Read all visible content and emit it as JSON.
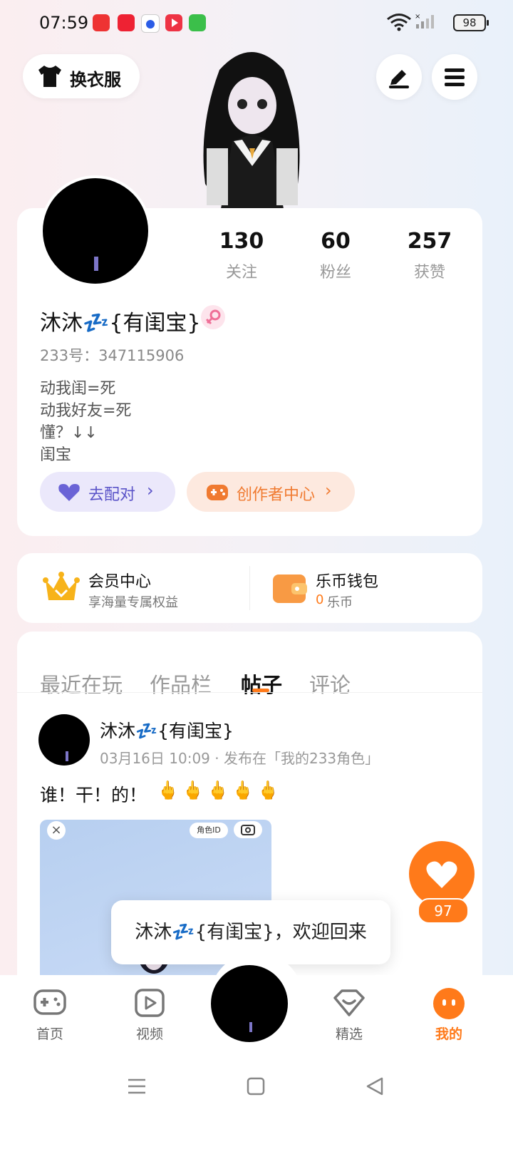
{
  "status_bar": {
    "time": "07:59",
    "battery": "98"
  },
  "header": {
    "outfit_label": "换衣服"
  },
  "profile": {
    "stats": [
      {
        "value": "130",
        "label": "关注"
      },
      {
        "value": "60",
        "label": "粉丝"
      },
      {
        "value": "257",
        "label": "获赞"
      }
    ],
    "name": "沐沐💤{有闺宝}",
    "account_id": "233号：347115906",
    "bio": [
      "动我闺=死",
      "动我好友=死",
      "懂？↓↓",
      "闺宝"
    ],
    "match_button": "去配对",
    "creator_button": "创作者中心"
  },
  "services": {
    "vip_title": "会员中心",
    "vip_subtitle": "享海量专属权益",
    "wallet_title": "乐币钱包",
    "wallet_amount": "0",
    "wallet_unit": "乐币"
  },
  "tabs": [
    "最近在玩",
    "作品栏",
    "帖子",
    "评论"
  ],
  "active_tab": "帖子",
  "post": {
    "author": "沐沐💤{有闺宝}",
    "meta": "03月16日 10:09 · 发布在「我的233角色」",
    "text": "谁！干！的！",
    "emojis": "🖕🖕🖕🖕🖕",
    "image_tag": "角色ID",
    "likes": "97"
  },
  "toast": "沐沐💤{有闺宝}，欢迎回来",
  "bottom_nav": [
    {
      "label": "首页",
      "icon": "gamepad-icon"
    },
    {
      "label": "视频",
      "icon": "video-icon"
    },
    {
      "label": "",
      "icon": "avatar"
    },
    {
      "label": "精选",
      "icon": "heart-shield-icon"
    },
    {
      "label": "我的",
      "icon": "profile-icon"
    }
  ],
  "colors": {
    "accent": "#ff7a1a",
    "match_bg": "#ebe8fb",
    "creator_bg": "#fde9df"
  }
}
